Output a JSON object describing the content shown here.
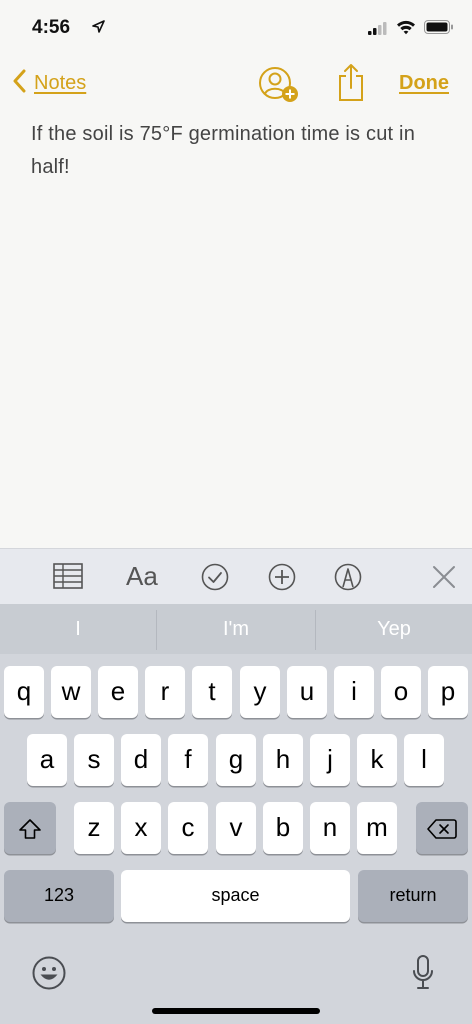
{
  "status": {
    "time": "4:56"
  },
  "nav": {
    "back_label": "Notes",
    "done_label": "Done"
  },
  "note": {
    "text": "If the soil is 75°F germination time is cut in half!"
  },
  "toolbar": {
    "format_label": "Aa"
  },
  "suggestions": [
    "I",
    "I'm",
    "Yep"
  ],
  "keyboard": {
    "row1": [
      "q",
      "w",
      "e",
      "r",
      "t",
      "y",
      "u",
      "i",
      "o",
      "p"
    ],
    "row2": [
      "a",
      "s",
      "d",
      "f",
      "g",
      "h",
      "j",
      "k",
      "l"
    ],
    "row3": [
      "z",
      "x",
      "c",
      "v",
      "b",
      "n",
      "m"
    ],
    "numbers_label": "123",
    "space_label": "space",
    "return_label": "return"
  },
  "colors": {
    "accent": "#d4a21a"
  }
}
